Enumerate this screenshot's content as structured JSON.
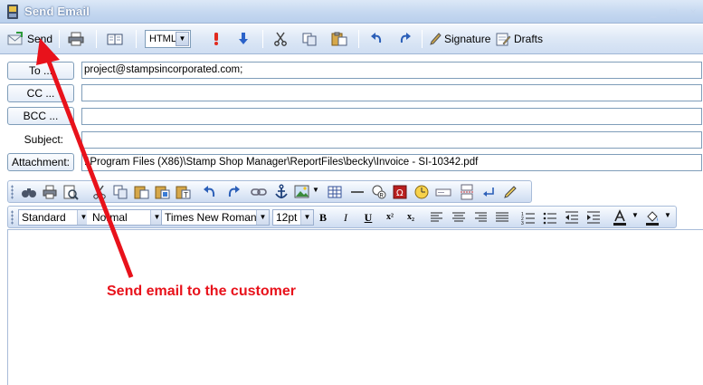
{
  "window": {
    "title": "Send Email",
    "controls": [
      "_",
      "□",
      "×"
    ]
  },
  "toolbar": {
    "send_label": "Send",
    "format_value": "HTML",
    "signature_label": "Signature",
    "drafts_label": "Drafts"
  },
  "fields": {
    "to_label": "To ...",
    "to_value": "project@stampsincorporated.com;",
    "cc_label": "CC ...",
    "cc_value": "",
    "bcc_label": "BCC ...",
    "bcc_value": "",
    "subject_label": "Subject:",
    "subject_value": "",
    "attachment_label": "Attachment:",
    "attachment_value": ":\\Program Files (X86)\\Stamp Shop Manager\\ReportFiles\\becky\\Invoice - SI-10342.pdf"
  },
  "editor": {
    "style_value": "Standard",
    "paragraph_value": "Normal",
    "font_value": "Times New Roman",
    "size_value": "12pt",
    "bold": "B",
    "italic": "I",
    "underline": "U",
    "superscript": "x²",
    "subscript": "x₂"
  },
  "annotation": {
    "text": "Send email to the customer",
    "color": "#e8121b"
  }
}
